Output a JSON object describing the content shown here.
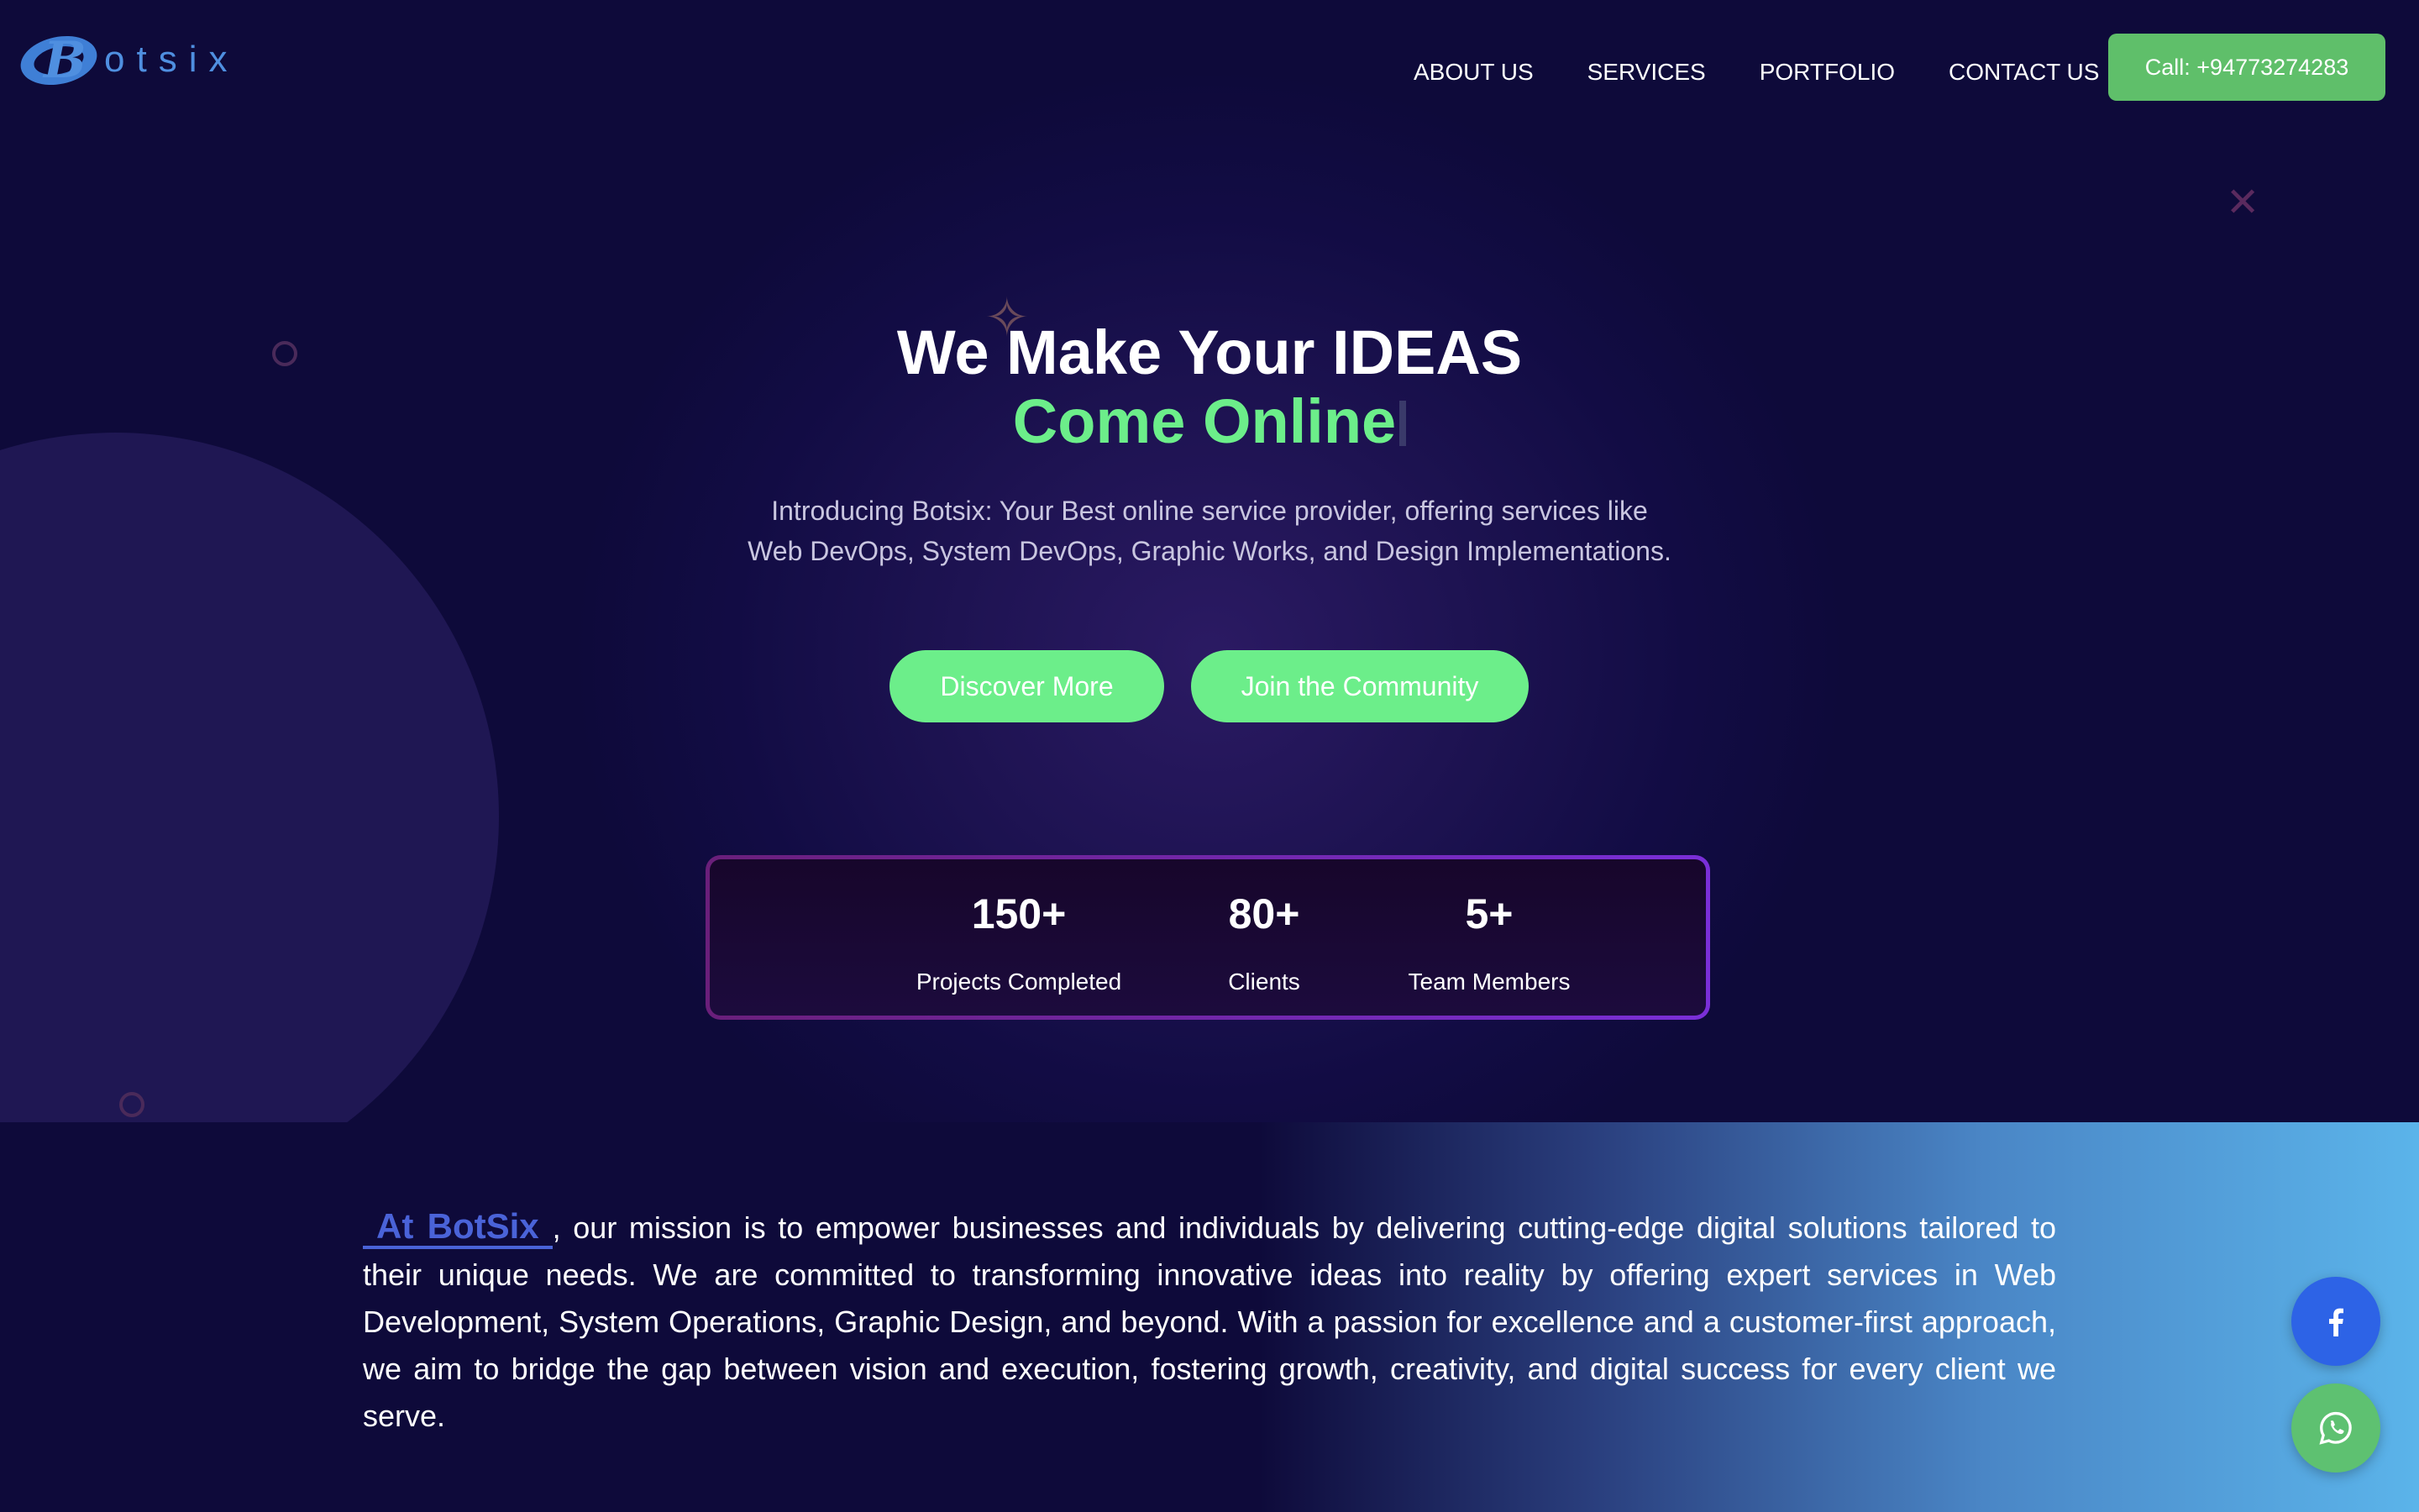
{
  "brand": {
    "logo_letters": "otsix",
    "logo_initial": "B"
  },
  "nav": {
    "items": [
      "ABOUT US",
      "SERVICES",
      "PORTFOLIO",
      "CONTACT US"
    ],
    "call_label": "Call: +94773274283"
  },
  "hero": {
    "title": "We Make Your IDEAS",
    "subtitle": "Come Online",
    "description": "Introducing Botsix: Your Best online service provider, offering services like Web DevOps, System DevOps, Graphic Works, and Design Implementations.",
    "buttons": {
      "discover": "Discover More",
      "join": "Join the Community"
    }
  },
  "stats": [
    {
      "value": "150+",
      "label": "Projects Completed"
    },
    {
      "value": "80+",
      "label": "Clients"
    },
    {
      "value": "5+",
      "label": "Team Members"
    }
  ],
  "mission": {
    "brand": "At BotSix",
    "text": ", our mission is to empower businesses and individuals by delivering cutting-edge digital solutions tailored to their unique needs. We are committed to transforming innovative ideas into reality by offering expert services in Web Development, System Operations, Graphic Design, and beyond. With a passion for excellence and a customer-first approach, we aim to bridge the gap between vision and execution, fostering growth, creativity, and digital success for every client we serve."
  },
  "social": {
    "facebook_icon": "facebook-icon",
    "whatsapp_icon": "whatsapp-icon"
  },
  "colors": {
    "accent_green": "#6cee8a",
    "call_green": "#5fbf6a",
    "brand_blue": "#4a63d8",
    "bg_navy": "#0e0a3a"
  }
}
